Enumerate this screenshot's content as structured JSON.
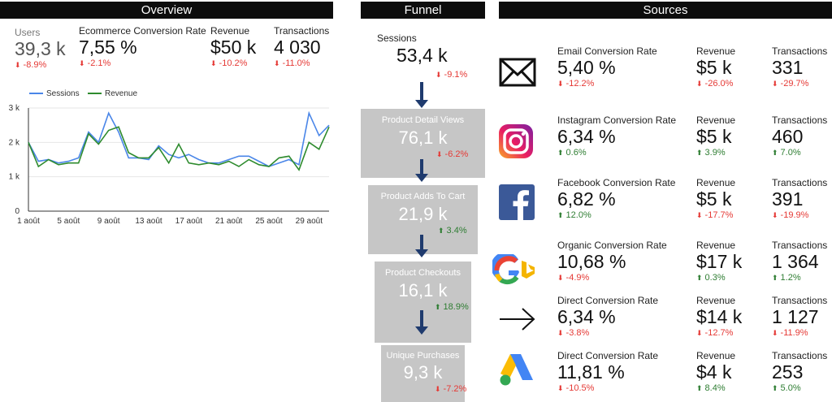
{
  "headers": {
    "overview": "Overview",
    "funnel": "Funnel",
    "sources": "Sources"
  },
  "overview": {
    "kpis": [
      {
        "label": "Users",
        "value": "39,3 k",
        "delta": "-8.9%",
        "dir": "down"
      },
      {
        "label": "Ecommerce Conversion Rate",
        "value": "7,55 %",
        "delta": "-2.1%",
        "dir": "down"
      },
      {
        "label": "Revenue",
        "value": "$50 k",
        "delta": "-10.2%",
        "dir": "down"
      },
      {
        "label": "Transactions",
        "value": "4 030",
        "delta": "-11.0%",
        "dir": "down"
      }
    ]
  },
  "chart_data": {
    "type": "line",
    "x": [
      "1 août",
      "2",
      "3",
      "4",
      "5 août",
      "6",
      "7",
      "8",
      "9 août",
      "10",
      "11",
      "12",
      "13 août",
      "14",
      "15",
      "16",
      "17 août",
      "18",
      "19",
      "20",
      "21 août",
      "22",
      "23",
      "24",
      "25 août",
      "26",
      "27",
      "28",
      "29 août",
      "30",
      "31"
    ],
    "xticks": [
      "1 août",
      "5 août",
      "9 août",
      "13 août",
      "17 août",
      "21 août",
      "25 août",
      "29 août"
    ],
    "ylim": [
      0,
      3000
    ],
    "yticks": [
      "0",
      "1 k",
      "2 k",
      "3 k"
    ],
    "grid": true,
    "legend": "top-left",
    "series": [
      {
        "name": "Sessions",
        "color": "#4a86e8",
        "values": [
          2000,
          1450,
          1500,
          1400,
          1450,
          1550,
          2300,
          2000,
          2850,
          2300,
          1550,
          1550,
          1500,
          1900,
          1650,
          1550,
          1650,
          1500,
          1400,
          1400,
          1500,
          1600,
          1600,
          1450,
          1300,
          1400,
          1500,
          1350,
          2850,
          2200,
          2500
        ]
      },
      {
        "name": "Revenue",
        "color": "#2e8b2e",
        "values": [
          2000,
          1300,
          1500,
          1350,
          1400,
          1400,
          2250,
          1950,
          2350,
          2450,
          1700,
          1550,
          1550,
          1850,
          1400,
          1950,
          1400,
          1350,
          1400,
          1350,
          1450,
          1300,
          1500,
          1350,
          1300,
          1550,
          1600,
          1200,
          2000,
          1800,
          2450
        ]
      }
    ]
  },
  "funnel": {
    "stages": [
      {
        "title": "Sessions",
        "value": "53,4 k",
        "delta": "-9.1%",
        "dir": "down"
      },
      {
        "title": "Product Detail Views",
        "value": "76,1 k",
        "delta": "-6.2%",
        "dir": "down"
      },
      {
        "title": "Product Adds To Cart",
        "value": "21,9 k",
        "delta": "3.4%",
        "dir": "up"
      },
      {
        "title": "Product Checkouts",
        "value": "16,1 k",
        "delta": "18.9%",
        "dir": "up"
      },
      {
        "title": "Unique Purchases",
        "value": "9,3 k",
        "delta": "-7.2%",
        "dir": "down"
      }
    ]
  },
  "sources": {
    "col_revenue": "Revenue",
    "col_transactions": "Transactions",
    "rows": [
      {
        "icon": "email-icon",
        "label": "Email Conversion Rate",
        "rate": "5,40 %",
        "rate_delta": "-12.2%",
        "rate_dir": "down",
        "revenue": "$5 k",
        "revenue_delta": "-26.0%",
        "revenue_dir": "down",
        "transactions": "331",
        "transactions_delta": "-29.7%",
        "transactions_dir": "down"
      },
      {
        "icon": "instagram-icon",
        "label": "Instagram Conversion Rate",
        "rate": "6,34 %",
        "rate_delta": "0.6%",
        "rate_dir": "up",
        "revenue": "$5 k",
        "revenue_delta": "3.9%",
        "revenue_dir": "up",
        "transactions": "460",
        "transactions_delta": "7.0%",
        "transactions_dir": "up"
      },
      {
        "icon": "facebook-icon",
        "label": "Facebook Conversion Rate",
        "rate": "6,82 %",
        "rate_delta": "12.0%",
        "rate_dir": "up",
        "revenue": "$5 k",
        "revenue_delta": "-17.7%",
        "revenue_dir": "down",
        "transactions": "391",
        "transactions_delta": "-19.9%",
        "transactions_dir": "down"
      },
      {
        "icon": "google-bing-icon",
        "label": "Organic Conversion Rate",
        "rate": "10,68 %",
        "rate_delta": "-4.9%",
        "rate_dir": "down",
        "revenue": "$17 k",
        "revenue_delta": "0.3%",
        "revenue_dir": "up",
        "transactions": "1 364",
        "transactions_delta": "1.2%",
        "transactions_dir": "up"
      },
      {
        "icon": "arrow-right-icon",
        "label": "Direct Conversion Rate",
        "rate": "6,34 %",
        "rate_delta": "-3.8%",
        "rate_dir": "down",
        "revenue": "$14 k",
        "revenue_delta": "-12.7%",
        "revenue_dir": "down",
        "transactions": "1 127",
        "transactions_delta": "-11.9%",
        "transactions_dir": "down"
      },
      {
        "icon": "google-ads-icon",
        "label": "Direct Conversion Rate",
        "rate": "11,81 %",
        "rate_delta": "-10.5%",
        "rate_dir": "down",
        "revenue": "$4 k",
        "revenue_delta": "8.4%",
        "revenue_dir": "up",
        "transactions": "253",
        "transactions_delta": "5.0%",
        "transactions_dir": "up"
      }
    ]
  }
}
